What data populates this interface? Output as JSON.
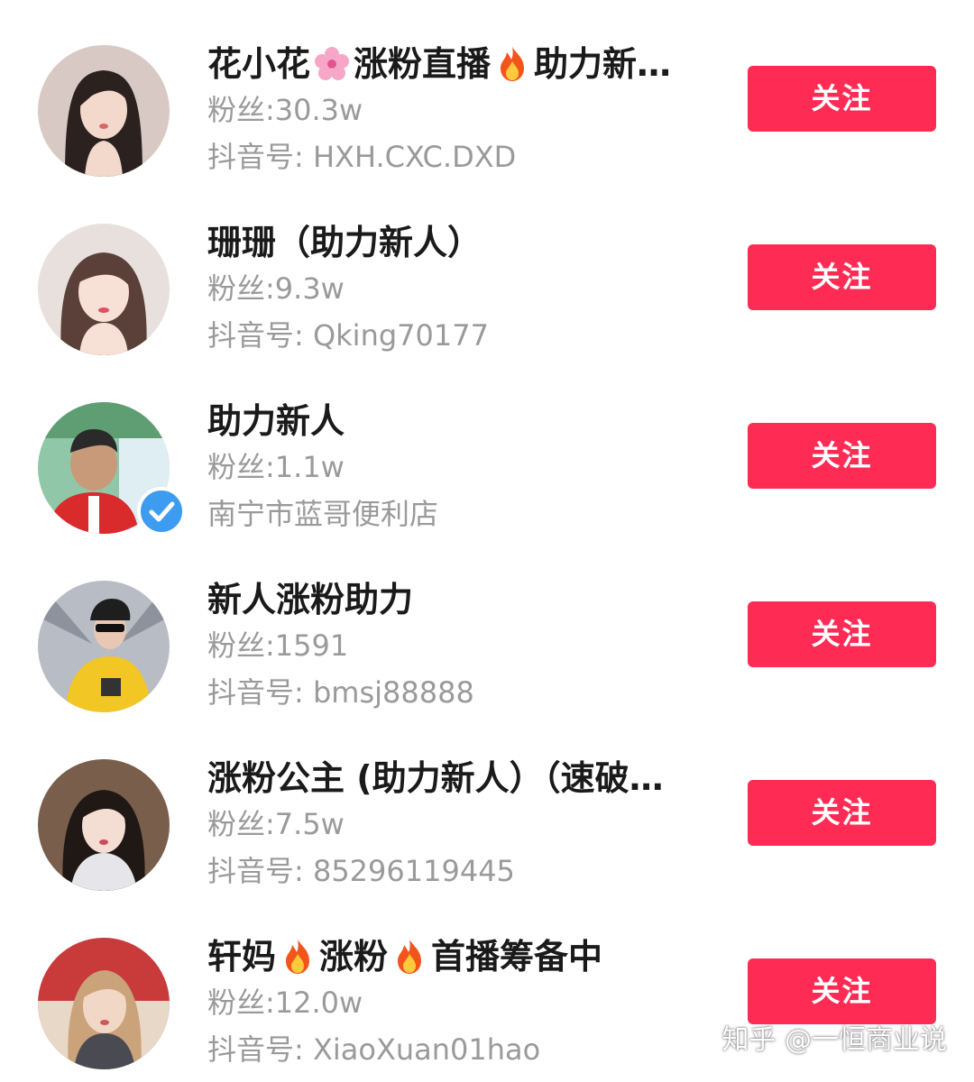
{
  "follow_label": "关注",
  "colors": {
    "accent": "#fe2c55",
    "verified": "#3d9cf0",
    "name_text": "#1a1a1a",
    "meta_text": "#9a9a9a"
  },
  "users": [
    {
      "name_parts": [
        "花小花",
        "涨粉直播",
        "助力新…"
      ],
      "icons": [
        "cherry-blossom-icon",
        "fire-icon"
      ],
      "fans": "粉丝:30.3w",
      "meta": "抖音号: HXH.CXC.DXD"
    },
    {
      "name_parts": [
        "珊珊（助力新人）"
      ],
      "fans": "粉丝:9.3w",
      "meta": "抖音号: Qking70177"
    },
    {
      "name_parts": [
        "助力新人"
      ],
      "verified": true,
      "fans": "粉丝:1.1w",
      "meta": "南宁市蓝哥便利店"
    },
    {
      "name_parts": [
        "新人涨粉助力"
      ],
      "fans": "粉丝:1591",
      "meta": "抖音号: bmsj88888"
    },
    {
      "name_parts": [
        "涨粉公主 (助力新人）（速破…"
      ],
      "fans": "粉丝:7.5w",
      "meta": "抖音号: 85296119445"
    },
    {
      "name_parts": [
        "轩妈",
        "涨粉",
        "首播筹备中"
      ],
      "icons": [
        "fire-icon",
        "fire-icon"
      ],
      "fans": "粉丝:12.0w",
      "meta": "抖音号: XiaoXuan01hao"
    }
  ],
  "watermark": "知乎 @一恒商业说"
}
